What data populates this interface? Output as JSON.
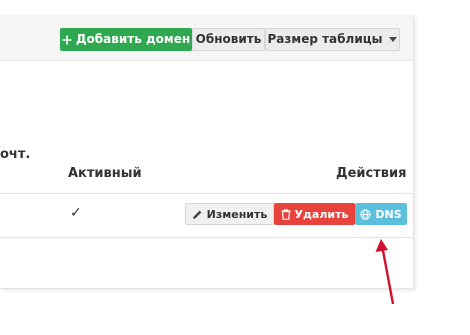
{
  "toolbar": {
    "add_domain_label": "Добавить домен",
    "add_icon": "plus-icon",
    "refresh_label": "Обновить",
    "table_size_label": "Размер таблицы"
  },
  "table": {
    "partial_header": "очт.",
    "columns": [
      "Активный",
      "Действия"
    ],
    "rows": [
      {
        "active_mark": "✓",
        "actions": {
          "edit_label": "Изменить",
          "delete_label": "Удалить",
          "dns_label": "DNS"
        }
      }
    ]
  },
  "colors": {
    "add_button": "#2fa84f",
    "delete_button": "#e8423d",
    "dns_button": "#5bc0de",
    "annotation_arrow": "#d0112b"
  }
}
